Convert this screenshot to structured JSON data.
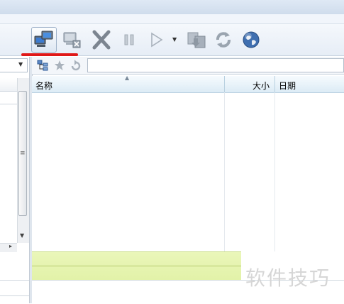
{
  "file_list": {
    "columns": [
      {
        "label": "名称",
        "sorted": "ascending"
      },
      {
        "label": "大小"
      },
      {
        "label": "日期"
      }
    ],
    "rows": []
  },
  "toolbar": {
    "buttons": [
      {
        "name": "connect",
        "icon": "computers-connect-icon",
        "state": "highlighted"
      },
      {
        "name": "disconnect",
        "icon": "computer-disconnect-icon"
      },
      {
        "name": "stop",
        "icon": "x-stop-icon"
      },
      {
        "name": "pause",
        "icon": "pause-icon"
      },
      {
        "name": "start",
        "icon": "play-icon"
      },
      {
        "name": "queue",
        "icon": "queue-transfer-icon"
      },
      {
        "name": "refresh",
        "icon": "refresh-icon"
      },
      {
        "name": "web",
        "icon": "globe-icon"
      }
    ],
    "highlight_color": "#e01818"
  },
  "watermark": "软件技巧",
  "status_color": "#e6f4b0"
}
